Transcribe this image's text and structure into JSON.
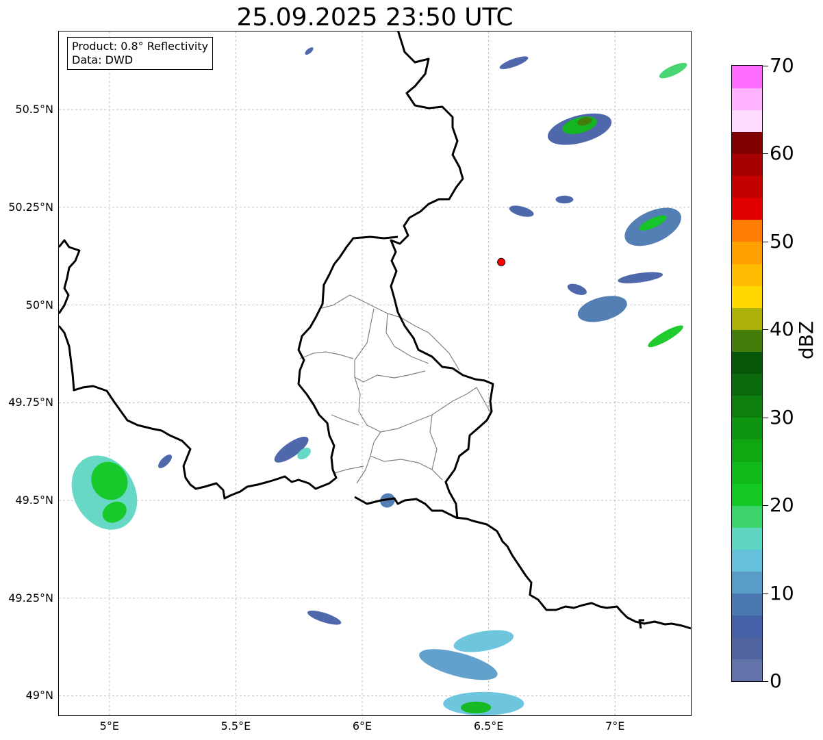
{
  "title": "25.09.2025 23:50 UTC",
  "info": {
    "product": "Product: 0.8° Reflectivity",
    "data": "Data: DWD"
  },
  "map": {
    "lon_range": [
      4.8,
      7.3
    ],
    "lat_range": [
      48.95,
      50.7
    ],
    "lon_ticks": [
      {
        "value": 5.0,
        "label": "5°E"
      },
      {
        "value": 5.5,
        "label": "5.5°E"
      },
      {
        "value": 6.0,
        "label": "6°E"
      },
      {
        "value": 6.5,
        "label": "6.5°E"
      },
      {
        "value": 7.0,
        "label": "7°E"
      }
    ],
    "lat_ticks": [
      {
        "value": 49.0,
        "label": "49°N"
      },
      {
        "value": 49.25,
        "label": "49.25°N"
      },
      {
        "value": 49.5,
        "label": "49.5°N"
      },
      {
        "value": 49.75,
        "label": "49.75°N"
      },
      {
        "value": 50.0,
        "label": "50°N"
      },
      {
        "value": 50.25,
        "label": "50.25°N"
      },
      {
        "value": 50.5,
        "label": "50.5°N"
      }
    ],
    "gridlines": true,
    "radar_site": {
      "lon": 6.55,
      "lat": 50.11,
      "color": "#ff0000"
    }
  },
  "colorbar": {
    "unit": "dBZ",
    "min": 0,
    "max": 70,
    "step": 2.5,
    "tick_labels": [
      "0",
      "10",
      "20",
      "30",
      "40",
      "50",
      "60",
      "70"
    ],
    "colors": [
      "#6173a8",
      "#5064a0",
      "#4460a6",
      "#4a78b0",
      "#5a9cc8",
      "#66c2dc",
      "#5fd6c2",
      "#3dd46c",
      "#14c823",
      "#12b91a",
      "#10a713",
      "#0e9411",
      "#0c7f0f",
      "#0a6a0d",
      "#055608",
      "#457c0a",
      "#adb20a",
      "#ffd800",
      "#ffbc00",
      "#ff9f00",
      "#ff7d00",
      "#e00000",
      "#c40000",
      "#a60000",
      "#800000",
      "#ffdcff",
      "#ffb3ff",
      "#ff6cff",
      "#e83ae8"
    ]
  },
  "echoes": [
    {
      "lon": 4.98,
      "lat": 49.52,
      "rx": 0.12,
      "ry": 0.1,
      "rot": -30,
      "level": 6
    },
    {
      "lon": 5.0,
      "lat": 49.55,
      "rx": 0.07,
      "ry": 0.05,
      "rot": -30,
      "level": 8
    },
    {
      "lon": 5.02,
      "lat": 49.47,
      "rx": 0.05,
      "ry": 0.025,
      "rot": -30,
      "level": 8
    },
    {
      "lon": 5.22,
      "lat": 49.6,
      "rx": 0.035,
      "ry": 0.01,
      "rot": -45,
      "level": 2
    },
    {
      "lon": 5.72,
      "lat": 49.63,
      "rx": 0.08,
      "ry": 0.018,
      "rot": -35,
      "level": 2
    },
    {
      "lon": 5.77,
      "lat": 49.62,
      "rx": 0.03,
      "ry": 0.012,
      "rot": -35,
      "level": 6
    },
    {
      "lon": 5.85,
      "lat": 49.2,
      "rx": 0.07,
      "ry": 0.012,
      "rot": 18,
      "level": 2
    },
    {
      "lon": 6.1,
      "lat": 49.5,
      "rx": 0.03,
      "ry": 0.018,
      "rot": -30,
      "level": 3
    },
    {
      "lon": 6.38,
      "lat": 49.08,
      "rx": 0.16,
      "ry": 0.03,
      "rot": 15,
      "level": 4
    },
    {
      "lon": 6.48,
      "lat": 49.14,
      "rx": 0.12,
      "ry": 0.025,
      "rot": -10,
      "level": 5
    },
    {
      "lon": 6.48,
      "lat": 48.98,
      "rx": 0.16,
      "ry": 0.03,
      "rot": 0,
      "level": 5
    },
    {
      "lon": 6.45,
      "lat": 48.97,
      "rx": 0.06,
      "ry": 0.015,
      "rot": 0,
      "level": 9
    },
    {
      "lon": 6.6,
      "lat": 50.62,
      "rx": 0.06,
      "ry": 0.01,
      "rot": -20,
      "level": 2
    },
    {
      "lon": 6.86,
      "lat": 50.45,
      "rx": 0.13,
      "ry": 0.035,
      "rot": -15,
      "level": 2
    },
    {
      "lon": 6.86,
      "lat": 50.46,
      "rx": 0.07,
      "ry": 0.02,
      "rot": -15,
      "level": 9
    },
    {
      "lon": 6.88,
      "lat": 50.47,
      "rx": 0.03,
      "ry": 0.01,
      "rot": -15,
      "level": 15
    },
    {
      "lon": 7.23,
      "lat": 50.6,
      "rx": 0.06,
      "ry": 0.012,
      "rot": -25,
      "level": 7
    },
    {
      "lon": 6.8,
      "lat": 50.27,
      "rx": 0.035,
      "ry": 0.01,
      "rot": 0,
      "level": 2
    },
    {
      "lon": 6.63,
      "lat": 50.24,
      "rx": 0.05,
      "ry": 0.012,
      "rot": 15,
      "level": 2
    },
    {
      "lon": 7.15,
      "lat": 50.2,
      "rx": 0.12,
      "ry": 0.04,
      "rot": -25,
      "level": 3
    },
    {
      "lon": 7.15,
      "lat": 50.21,
      "rx": 0.06,
      "ry": 0.012,
      "rot": -25,
      "level": 8
    },
    {
      "lon": 6.95,
      "lat": 49.99,
      "rx": 0.1,
      "ry": 0.03,
      "rot": -15,
      "level": 3
    },
    {
      "lon": 6.85,
      "lat": 50.04,
      "rx": 0.04,
      "ry": 0.012,
      "rot": 20,
      "level": 2
    },
    {
      "lon": 7.1,
      "lat": 50.07,
      "rx": 0.09,
      "ry": 0.012,
      "rot": -8,
      "level": 2
    },
    {
      "lon": 7.2,
      "lat": 49.92,
      "rx": 0.08,
      "ry": 0.012,
      "rot": -30,
      "level": 8
    },
    {
      "lon": 5.79,
      "lat": 50.65,
      "rx": 0.02,
      "ry": 0.006,
      "rot": -40,
      "level": 2
    }
  ]
}
